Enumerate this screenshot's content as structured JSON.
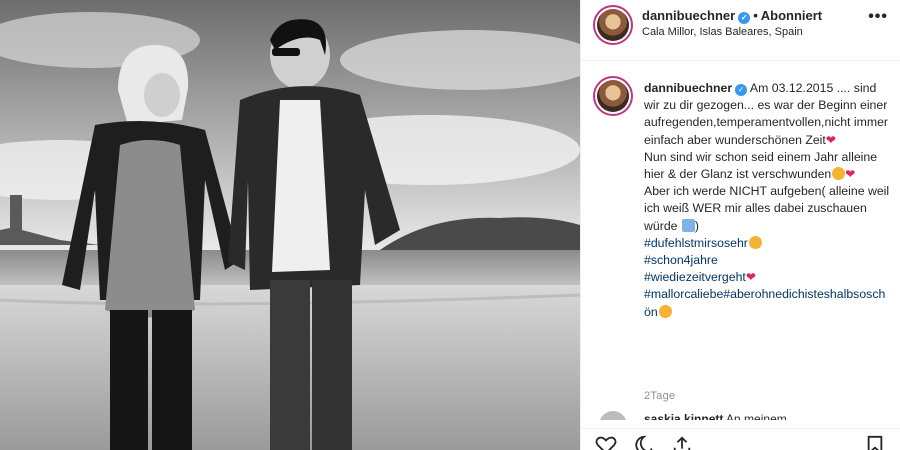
{
  "post": {
    "username": "dannibuechner",
    "follow_status": "Abonniert",
    "separator": "•",
    "location": "Cala Millor, Islas Baleares, Spain",
    "more_icon": "more-horizontal-icon"
  },
  "caption": {
    "username": "dannibuechner",
    "lines": [
      "Am 03.12.2015 .... sind wir zu dir gezogen... es war der Beginn einer aufregenden,temperamentvollen,nicht immer einfach aber wunderschönen Zeit",
      "Nun sind wir schon seid einem Jahr alleine hier & der Glanz ist verschwunden",
      "Aber ich werde NICHT aufgeben( alleine weil ich weiß WER mir alles dabei zuschauen würde",
      ")"
    ],
    "hashtags": [
      "#dufehlstmirsosehr",
      "#schon4jahre",
      "#wiediezeitvergeht",
      "#mallorcaliebe#aberohnedichisteshalbsoschön"
    ],
    "emojis": [
      "red-heart",
      "sad-face",
      "broken-heart",
      "praying-hands"
    ]
  },
  "time_ago": "2Tage",
  "comment_peek": {
    "username": "saskia.kinnett",
    "text": "An meinem"
  },
  "colors": {
    "link": "#003569",
    "verified": "#3897f0",
    "story_ring": "#c13584",
    "muted": "#8e8e8e",
    "heart": "#e0245e"
  }
}
